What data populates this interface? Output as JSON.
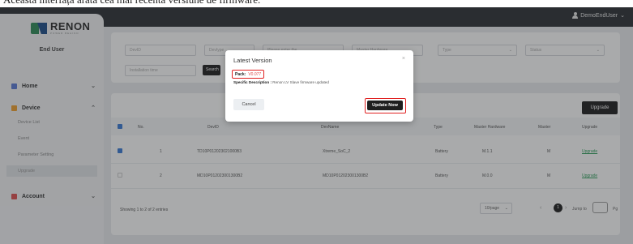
{
  "caption": "Această interfață arată cea mai recentă versiune de firmware.",
  "topbar": {
    "user": "DemoEndUser",
    "user_icon": "user-icon",
    "chevron": "⌄"
  },
  "sidebar": {
    "brand": "RENON",
    "brand_sub": "POWER BEHIND",
    "role": "End User",
    "home": {
      "label": "Home",
      "icon": "home-icon",
      "color": "#5b7bd5"
    },
    "device": {
      "label": "Device",
      "icon": "device-icon",
      "color": "#f0a030",
      "items": [
        "Device List",
        "Event",
        "Parameter Setting",
        "Upgrade"
      ],
      "active": "Upgrade"
    },
    "account": {
      "label": "Account",
      "icon": "account-icon",
      "color": "#e05050"
    },
    "chev_down": "⌄",
    "chev_up": "⌃"
  },
  "filters": {
    "dev_id": "DevID",
    "field2": "DevIype",
    "field3": "Please enter the ...",
    "field4": "Master Hardware ...",
    "type": "Type",
    "status": "Status",
    "installation_time": "Installation time",
    "search": "Search"
  },
  "table": {
    "upgrade_label": "Upgrade",
    "headers": [
      "No.",
      "DevID",
      "DevName",
      "Type",
      "Master Hardware",
      "Master",
      "Upgrade"
    ],
    "rows": [
      {
        "no": "1",
        "devid": "TD10P012023021000B3",
        "devname": "Xtreme_SoC_2",
        "type": "Battery",
        "master_hw": "M.1.1",
        "master": "M",
        "upgrade": "Upgrade",
        "checked": true
      },
      {
        "no": "2",
        "devid": "MD10P012023001300B2",
        "devname": "MD10P012023001300B2",
        "type": "Battery",
        "master_hw": "M.0.0",
        "master": "M",
        "upgrade": "Upgrade",
        "checked": false
      }
    ]
  },
  "pagination": {
    "info": "Showing 1 to 2 of 2 entries",
    "page_size": "10/page",
    "page": "1",
    "jump_to": "Jump to",
    "pg": "Pg",
    "prev": "‹",
    "next": "›"
  },
  "modal": {
    "title": "Latest Version",
    "close": "×",
    "pack_label": "Pack:",
    "pack_version": "V0.077",
    "desc_label": "Specific Description :",
    "desc_text": "Renon LV Slave firmware updated",
    "cancel": "Cancel",
    "update": "Update Now"
  },
  "colors": {
    "highlight": "#e02020",
    "link": "#2e9e5b",
    "primary_button": "#1f1f1f",
    "checkbox": "#3a7bd5"
  }
}
